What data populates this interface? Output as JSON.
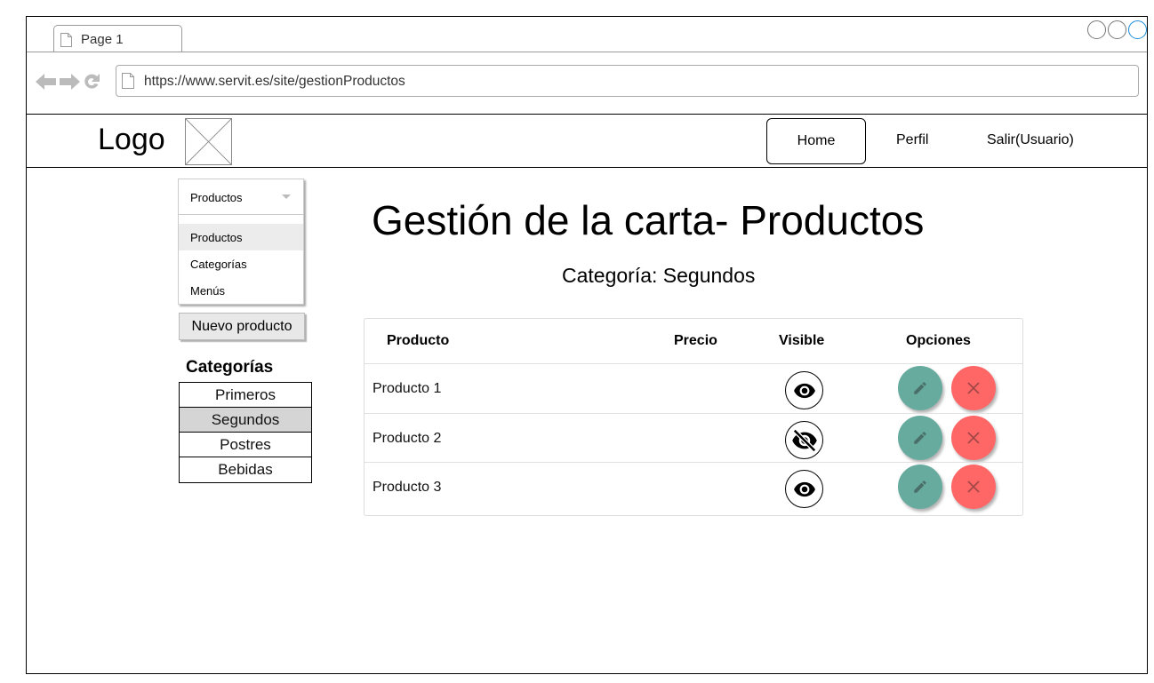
{
  "browser": {
    "tab_label": "Page 1",
    "url": "https://www.servit.es/site/gestionProductos"
  },
  "header": {
    "logo_text": "Logo",
    "nav": {
      "home": "Home",
      "perfil": "Perfil",
      "salir": "Salir(Usuario)"
    }
  },
  "sidebar": {
    "dropdown": {
      "selected": "Productos",
      "options": [
        "Productos",
        "Categorías",
        "Menús"
      ]
    },
    "new_button": "Nuevo producto",
    "categories_title": "Categorías",
    "categories": [
      "Primeros",
      "Segundos",
      "Postres",
      "Bebidas"
    ],
    "active_category": "Segundos"
  },
  "main": {
    "title": "Gestión de la carta- Productos",
    "subtitle": "Categoría: Segundos",
    "table": {
      "headers": [
        "Producto",
        "Precio",
        "Visible",
        "Opciones"
      ],
      "rows": [
        {
          "name": "Producto 1",
          "precio": "",
          "visible": true
        },
        {
          "name": "Producto 2",
          "precio": "",
          "visible": false
        },
        {
          "name": "Producto 3",
          "precio": "",
          "visible": true
        }
      ]
    }
  },
  "colors": {
    "edit_button": "#67ab9f",
    "delete_button": "#ff6666",
    "active_item": "#d5d5d5"
  }
}
